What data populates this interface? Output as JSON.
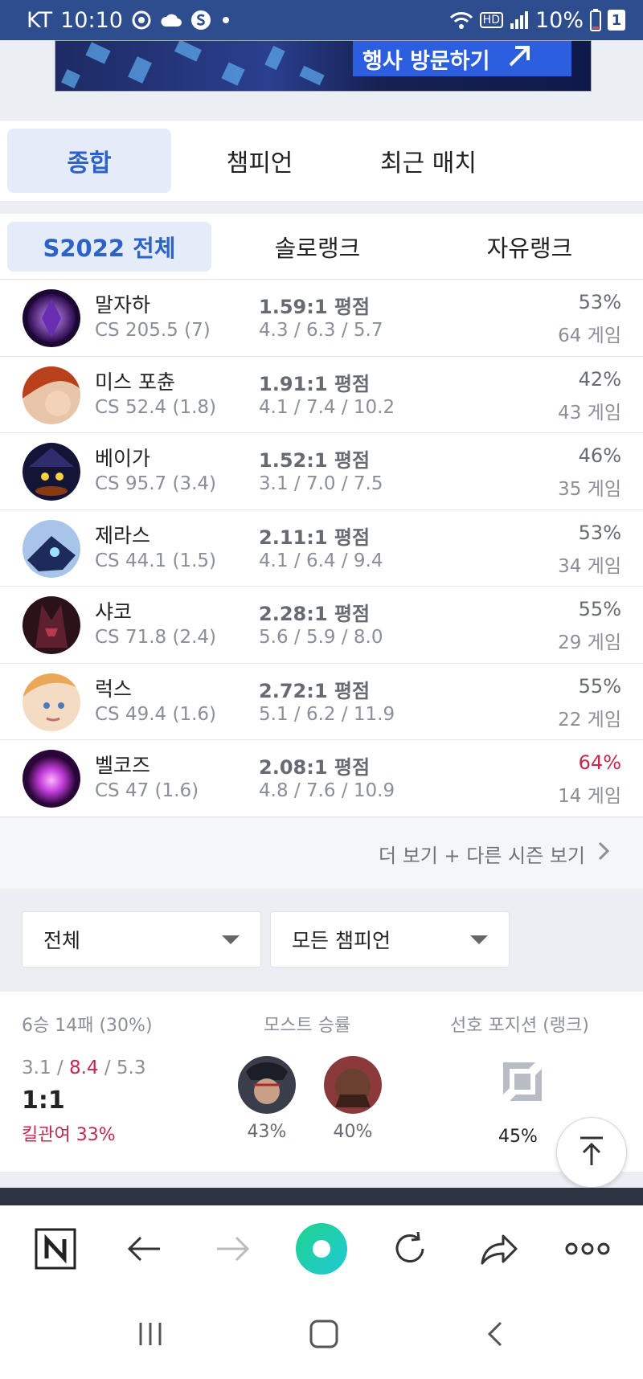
{
  "status_bar": {
    "carrier": "KT",
    "time": "10:10",
    "network_badge": "HD",
    "battery": "10%",
    "sim_badge": "1"
  },
  "ad": {
    "button_label": "행사 방문하기"
  },
  "main_tabs": [
    {
      "label": "종합",
      "active": true
    },
    {
      "label": "챔피언",
      "active": false
    },
    {
      "label": "최근 매치",
      "active": false
    }
  ],
  "season_tabs": [
    {
      "label": "S2022 전체",
      "active": true
    },
    {
      "label": "솔로랭크",
      "active": false
    },
    {
      "label": "자유랭크",
      "active": false
    }
  ],
  "champions": [
    {
      "name": "말자하",
      "cs": "CS 205.5 (7)",
      "kda": "1.59:1 평점",
      "avg": "4.3 / 6.3 / 5.7",
      "winrate": "53%",
      "games": "64 게임"
    },
    {
      "name": "미스 포츈",
      "cs": "CS 52.4 (1.8)",
      "kda": "1.91:1 평점",
      "avg": "4.1 / 7.4 / 10.2",
      "winrate": "42%",
      "games": "43 게임"
    },
    {
      "name": "베이가",
      "cs": "CS 95.7 (3.4)",
      "kda": "1.52:1 평점",
      "avg": "3.1 / 7.0 / 7.5",
      "winrate": "46%",
      "games": "35 게임"
    },
    {
      "name": "제라스",
      "cs": "CS 44.1 (1.5)",
      "kda": "2.11:1 평점",
      "avg": "4.1 / 6.4 / 9.4",
      "winrate": "53%",
      "games": "34 게임"
    },
    {
      "name": "샤코",
      "cs": "CS 71.8 (2.4)",
      "kda": "2.28:1 평점",
      "avg": "5.6 / 5.9 / 8.0",
      "winrate": "55%",
      "games": "29 게임"
    },
    {
      "name": "럭스",
      "cs": "CS 49.4 (1.6)",
      "kda": "2.72:1 평점",
      "avg": "5.1 / 6.2 / 11.9",
      "winrate": "55%",
      "games": "22 게임"
    },
    {
      "name": "벨코즈",
      "cs": "CS 47 (1.6)",
      "kda": "2.08:1 평점",
      "avg": "4.8 / 7.6 / 10.9",
      "winrate": "64%",
      "games": "14 게임"
    }
  ],
  "colors": {
    "accent": "#2d62c8",
    "status_bar": "#2d4d8f",
    "highlight_red": "#c7284a",
    "tab_active_bg": "#e4ecf9"
  },
  "more_link": "더 보기 + 다른 시즌 보기",
  "filters": {
    "queue": "전체",
    "champion": "모든 챔피언"
  },
  "summary": {
    "record": "6승 14패 (30%)",
    "kills": "3.1",
    "deaths": "8.4",
    "assists": "5.3",
    "slash": "/",
    "ratio": "1:1",
    "kill_participation": "킬관여 33%",
    "most_title": "모스트 승률",
    "most": [
      {
        "winrate": "43%"
      },
      {
        "winrate": "40%"
      }
    ],
    "position_title": "선호 포지션 (랭크)",
    "position_pct": "45%"
  }
}
